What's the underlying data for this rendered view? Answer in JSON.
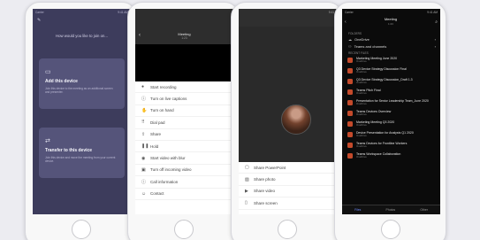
{
  "screen1": {
    "status_left": "Carrier",
    "status_time": "9:41 AM",
    "top_icon": "edit-icon",
    "question": "How would you like to join on...",
    "cards": [
      {
        "icon": "laptop-icon",
        "title": "Add this device",
        "desc": "Join this device to the meeting as an additional screen and presenter."
      },
      {
        "icon": "phone-transfer-icon",
        "title": "Transfer to this device",
        "desc": "Join this device and move the meeting from your current device."
      }
    ]
  },
  "screen2": {
    "title": "Meeting",
    "subtitle": "1:23",
    "items": [
      {
        "icon": "record-icon",
        "label": "Start recording"
      },
      {
        "icon": "info-icon",
        "label": "Turn on live captions"
      },
      {
        "icon": "hand-icon",
        "label": "Turn on hand"
      },
      {
        "icon": "keypad-icon",
        "label": "Dial pad"
      },
      {
        "icon": "share-icon",
        "label": "Share"
      },
      {
        "icon": "hold-icon",
        "label": "Hold"
      },
      {
        "icon": "blur-icon",
        "label": "Start video with blur"
      },
      {
        "icon": "video-off-icon",
        "label": "Turn off incoming video"
      },
      {
        "icon": "info-icon",
        "label": "Call information"
      },
      {
        "icon": "contact-icon",
        "label": "Contact"
      }
    ]
  },
  "screen3": {
    "status_time": "9:41",
    "items": [
      {
        "icon": "ppt-icon",
        "label": "Share PowerPoint"
      },
      {
        "icon": "photo-icon",
        "label": "Share photo"
      },
      {
        "icon": "video-icon",
        "label": "Share video"
      },
      {
        "icon": "screen-icon",
        "label": "Share screen"
      }
    ]
  },
  "screen4": {
    "status_left": "Carrier",
    "status_time": "9:41 AM",
    "title": "Meeting",
    "subtitle": "1:23",
    "folders_label": "FOLDERS",
    "folders": [
      {
        "icon": "cloud-icon",
        "label": "OneDrive"
      },
      {
        "icon": "teams-icon",
        "label": "Teams and channels"
      }
    ],
    "recent_label": "RECENT FILES",
    "recent": [
      {
        "title": "Marketing Meeting June 2020",
        "sub": "OneDrive"
      },
      {
        "title": "Q3 Device Strategy Discussion Final",
        "sub": "OneDrive"
      },
      {
        "title": "Q3 Device Strategy Discussion_Draft 1.3",
        "sub": "OneDrive"
      },
      {
        "title": "Teams Pitch Final",
        "sub": "OneDrive"
      },
      {
        "title": "Presentation for Senior Leadership Team_June 2020",
        "sub": "OneDrive"
      },
      {
        "title": "Teams Devices Overview",
        "sub": "OneDrive"
      },
      {
        "title": "Marketing Meeting Q3 2020",
        "sub": "OneDrive"
      },
      {
        "title": "Device Presentation for Analysts Q1 2020",
        "sub": "OneDrive"
      },
      {
        "title": "Teams Devices for Frontline Workers",
        "sub": "OneDrive"
      },
      {
        "title": "Teams Workspace Collaboration",
        "sub": "OneDrive"
      }
    ],
    "tabs": [
      {
        "label": "Files",
        "active": true
      },
      {
        "label": "Photos"
      },
      {
        "label": "Other"
      }
    ]
  },
  "colors": {
    "screen1_bg": "#3d3c5c",
    "card_bg": "#55547a",
    "ppt_orange": "#c44a2b",
    "active_tab": "#6f8cff"
  }
}
